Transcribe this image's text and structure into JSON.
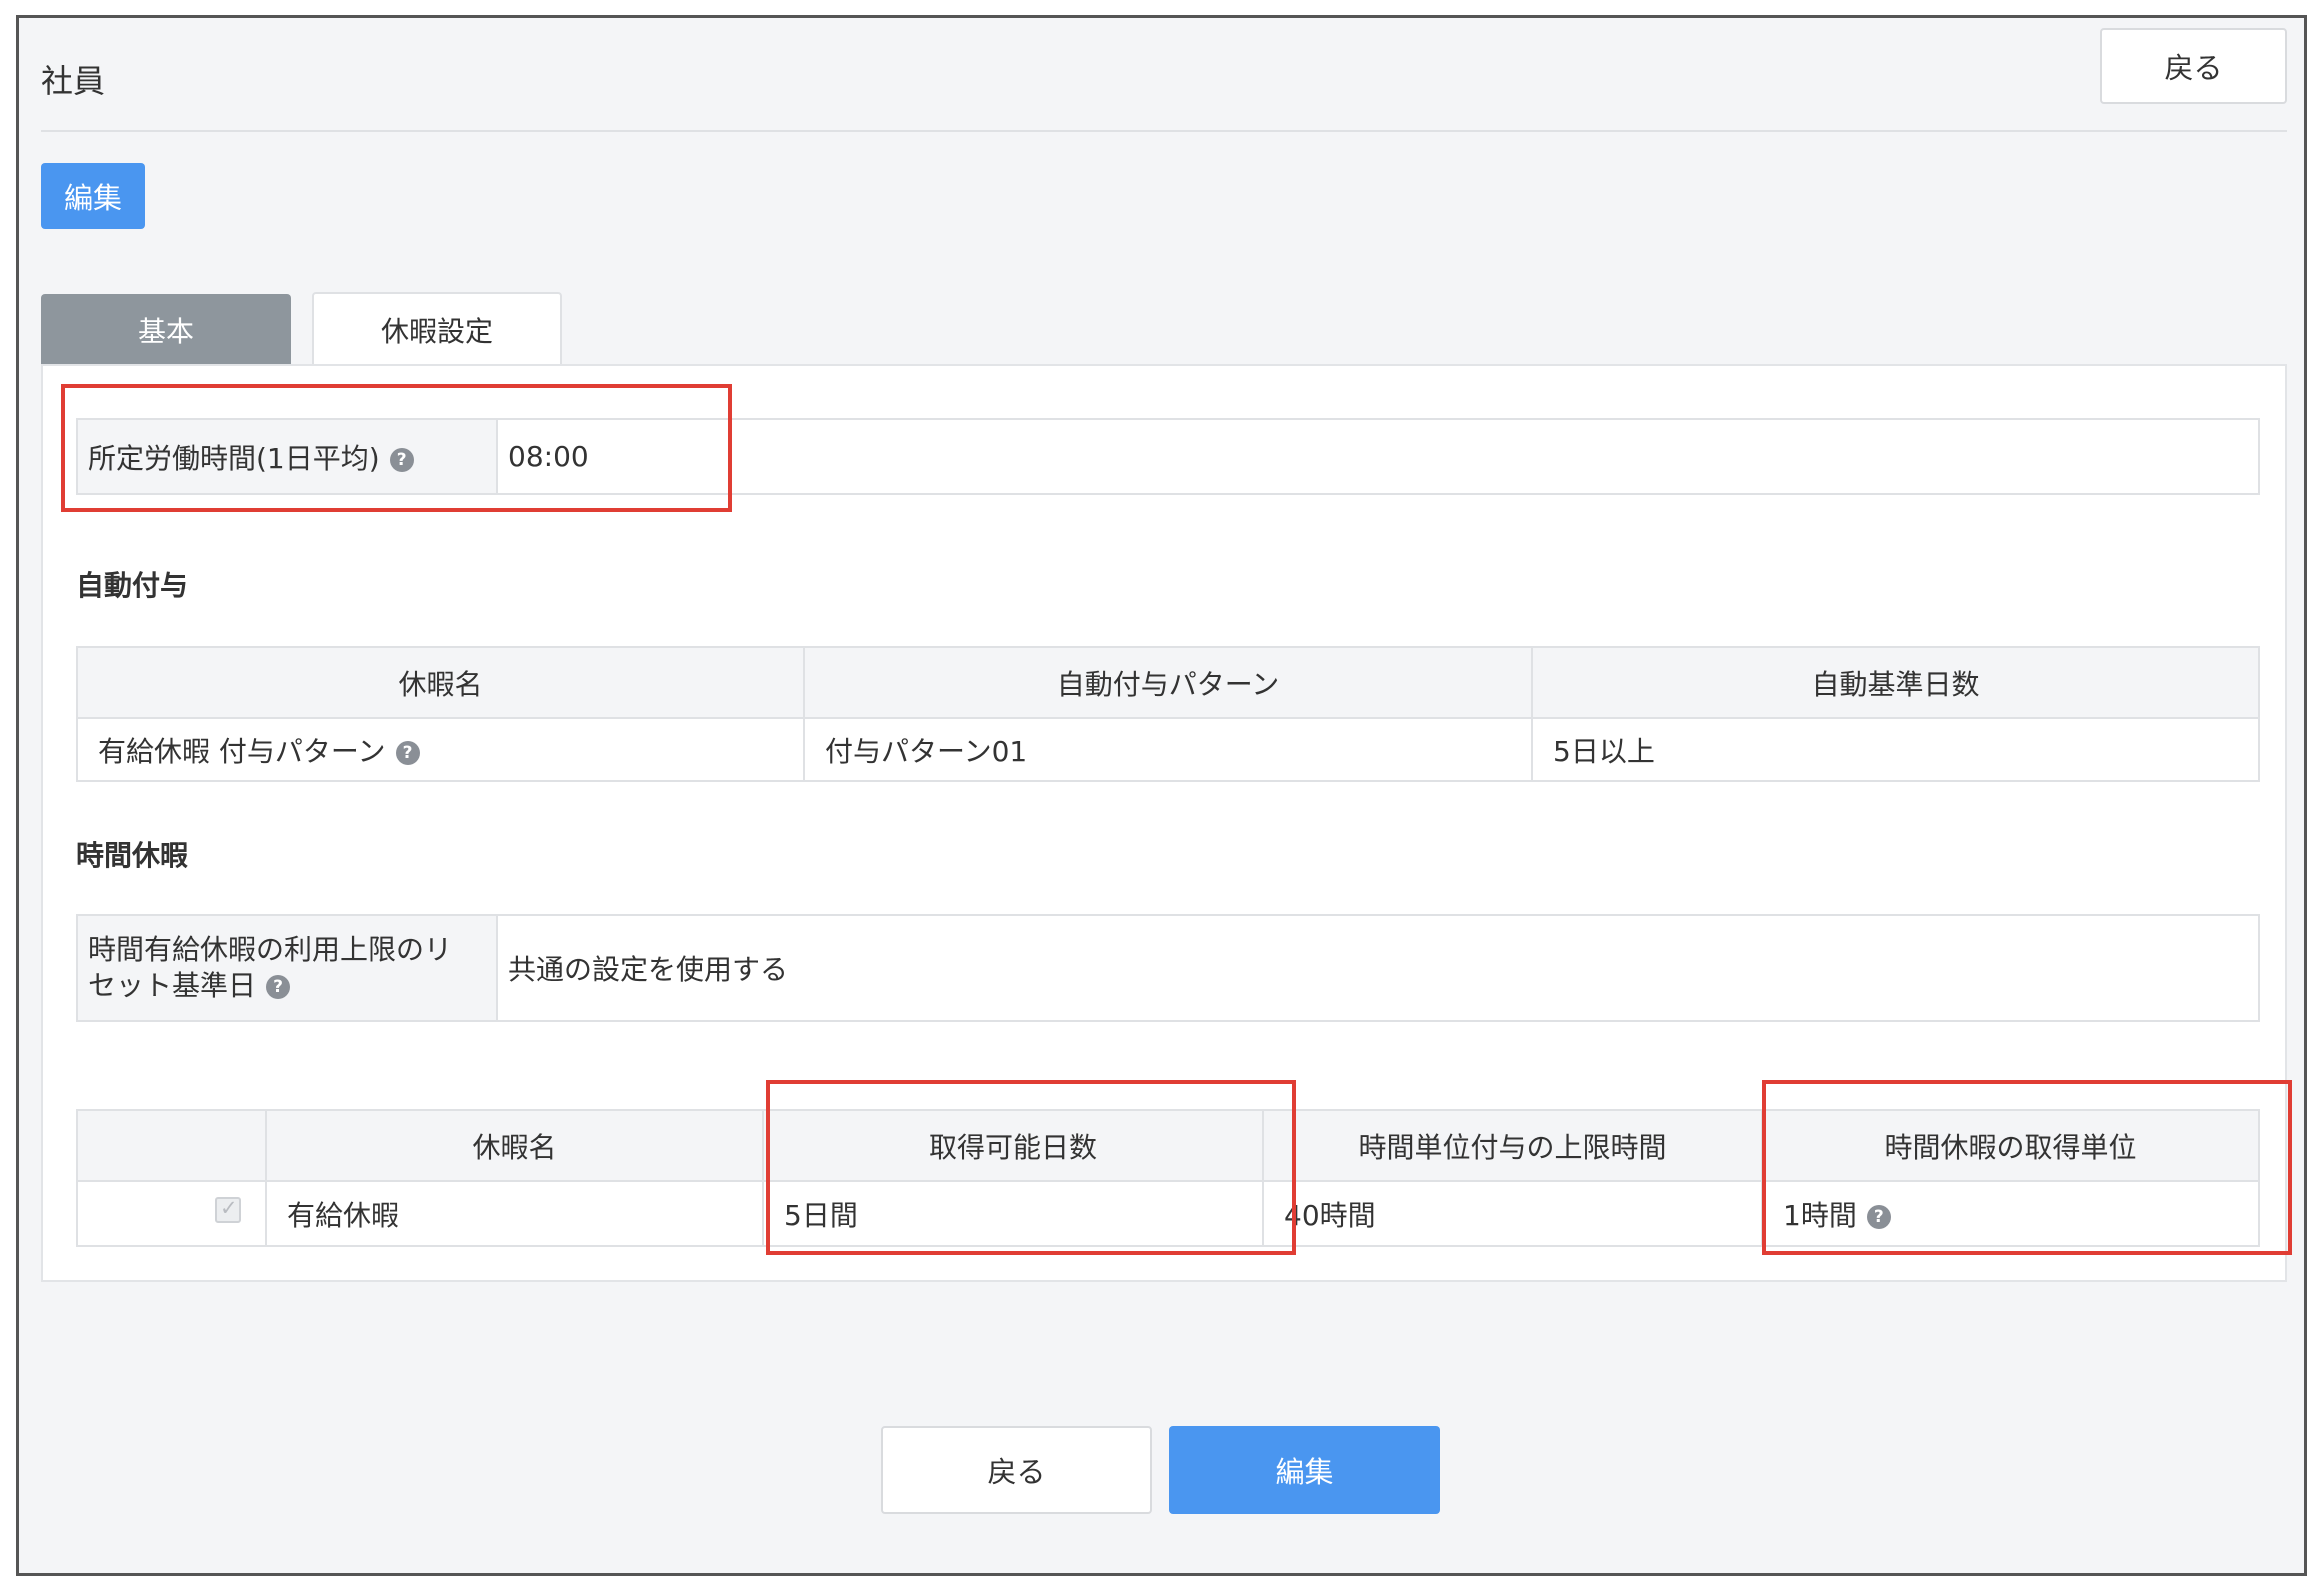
{
  "header": {
    "title": "社員",
    "back_label": "戻る",
    "edit_label": "編集"
  },
  "tabs": [
    {
      "label": "基本",
      "active": false
    },
    {
      "label": "休暇設定",
      "active": true
    }
  ],
  "work_hours": {
    "label": "所定労働時間(1日平均)",
    "value": "08:00"
  },
  "auto_grant": {
    "title": "自動付与",
    "columns": [
      "休暇名",
      "自動付与パターン",
      "自動基準日数"
    ],
    "rows": [
      {
        "name": "有給休暇 付与パターン",
        "pattern": "付与パターン01",
        "days": "5日以上"
      }
    ]
  },
  "hourly_leave": {
    "title": "時間休暇",
    "reset_label": "時間有給休暇の利用上限のリセット基準日",
    "reset_value": "共通の設定を使用する",
    "columns": [
      "",
      "休暇名",
      "取得可能日数",
      "時間単位付与の上限時間",
      "時間休暇の取得単位"
    ],
    "rows": [
      {
        "checked": true,
        "name": "有給休暇",
        "available_days": "5日間",
        "max_hours": "40時間",
        "unit": "1時間"
      }
    ]
  },
  "footer": {
    "back_label": "戻る",
    "edit_label": "編集"
  },
  "colors": {
    "primary": "#4a96f0",
    "highlight": "#e03d34",
    "tab_inactive": "#8e969d"
  },
  "icons": {
    "help": "question-circle-icon"
  }
}
